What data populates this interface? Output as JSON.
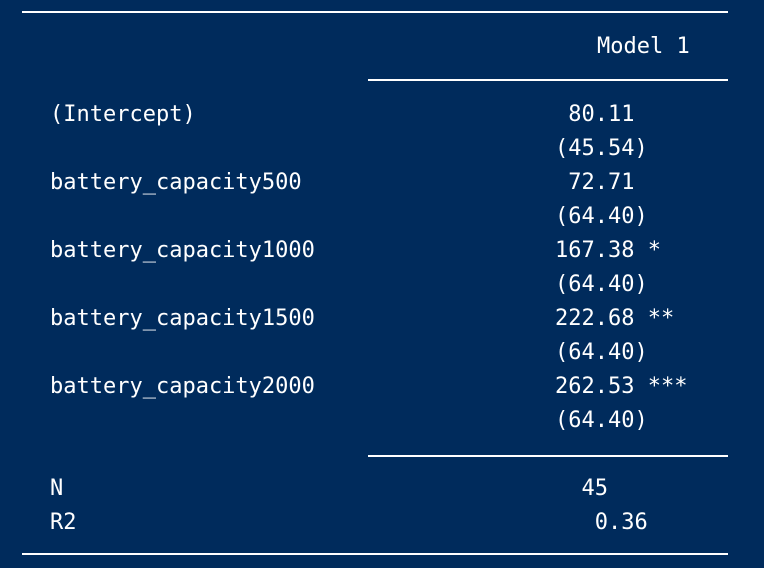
{
  "table": {
    "model_header": "Model 1",
    "rows": [
      {
        "term": "(Intercept)",
        "estimate": " 80.11",
        "se": "(45.54)"
      },
      {
        "term": "battery_capacity500",
        "estimate": " 72.71",
        "se": "(64.40)"
      },
      {
        "term": "battery_capacity1000",
        "estimate": "167.38 *",
        "se": "(64.40)"
      },
      {
        "term": "battery_capacity1500",
        "estimate": "222.68 **",
        "se": "(64.40)"
      },
      {
        "term": "battery_capacity2000",
        "estimate": "262.53 ***",
        "se": "(64.40)"
      }
    ],
    "stats": [
      {
        "label": "N",
        "value": "  45"
      },
      {
        "label": "R2",
        "value": "   0.36"
      }
    ]
  }
}
